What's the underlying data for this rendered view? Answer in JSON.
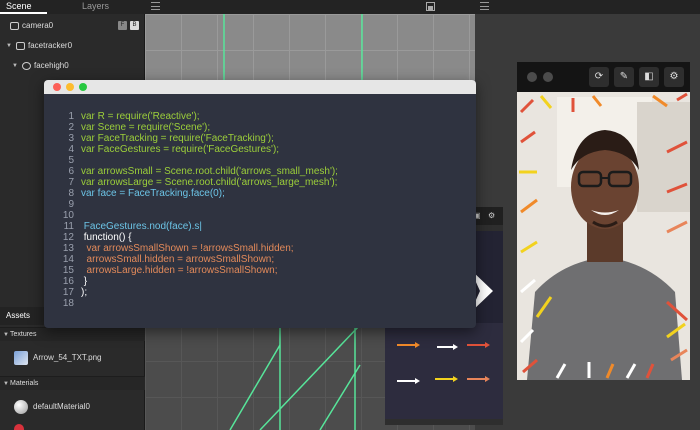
{
  "tabs": {
    "scene": "Scene",
    "layers": "Layers"
  },
  "scene_tree": {
    "items": [
      {
        "label": "camera0"
      },
      {
        "label": "facetracker0"
      },
      {
        "label": "facehigh0"
      }
    ]
  },
  "assets": {
    "title": "Assets",
    "textures": {
      "header": "Textures",
      "items": [
        {
          "label": "Arrow_54_TXT.png"
        }
      ]
    },
    "materials": {
      "header": "Materials",
      "items": [
        {
          "label": "defaultMaterial0"
        }
      ]
    }
  },
  "code": {
    "lines": [
      {
        "n": "1",
        "text": "var R = require('Reactive');"
      },
      {
        "n": "2",
        "text": "var Scene = require('Scene');"
      },
      {
        "n": "3",
        "text": "var FaceTracking = require('FaceTracking');"
      },
      {
        "n": "4",
        "text": "var FaceGestures = require('FaceGestures');"
      },
      {
        "n": "5",
        "text": ""
      },
      {
        "n": "6",
        "text": "var arrowsSmall = Scene.root.child('arrows_small_mesh');"
      },
      {
        "n": "7",
        "text": "var arrowsLarge = Scene.root.child('arrows_large_mesh');"
      },
      {
        "n": "8",
        "text": "var face = FaceTracking.face(0);"
      },
      {
        "n": "9",
        "text": ""
      },
      {
        "n": "10",
        "text": ""
      },
      {
        "n": "11",
        "text": " FaceGestures.nod(face).s|"
      },
      {
        "n": "12",
        "text": " function() {"
      },
      {
        "n": "13",
        "text": "  var arrowsSmallShown = !arrowsSmall.hidden;"
      },
      {
        "n": "14",
        "text": "  arrowsSmall.hidden = arrowsSmallShown;"
      },
      {
        "n": "15",
        "text": "  arrowsLarge.hidden = !arrowsSmallShown;"
      },
      {
        "n": "16",
        "text": " }"
      },
      {
        "n": "17",
        "text": ");"
      },
      {
        "n": "18",
        "text": ""
      }
    ]
  },
  "colors": {
    "accent_green": "#9ccf3a",
    "accent_orange": "#e38a5a",
    "accent_cyan": "#6cc4e6",
    "grid_line": "#4fdc8c"
  },
  "icons": {
    "camera_toolbar": [
      "refresh-icon",
      "brush-icon",
      "layout-icon",
      "gear-icon"
    ]
  }
}
